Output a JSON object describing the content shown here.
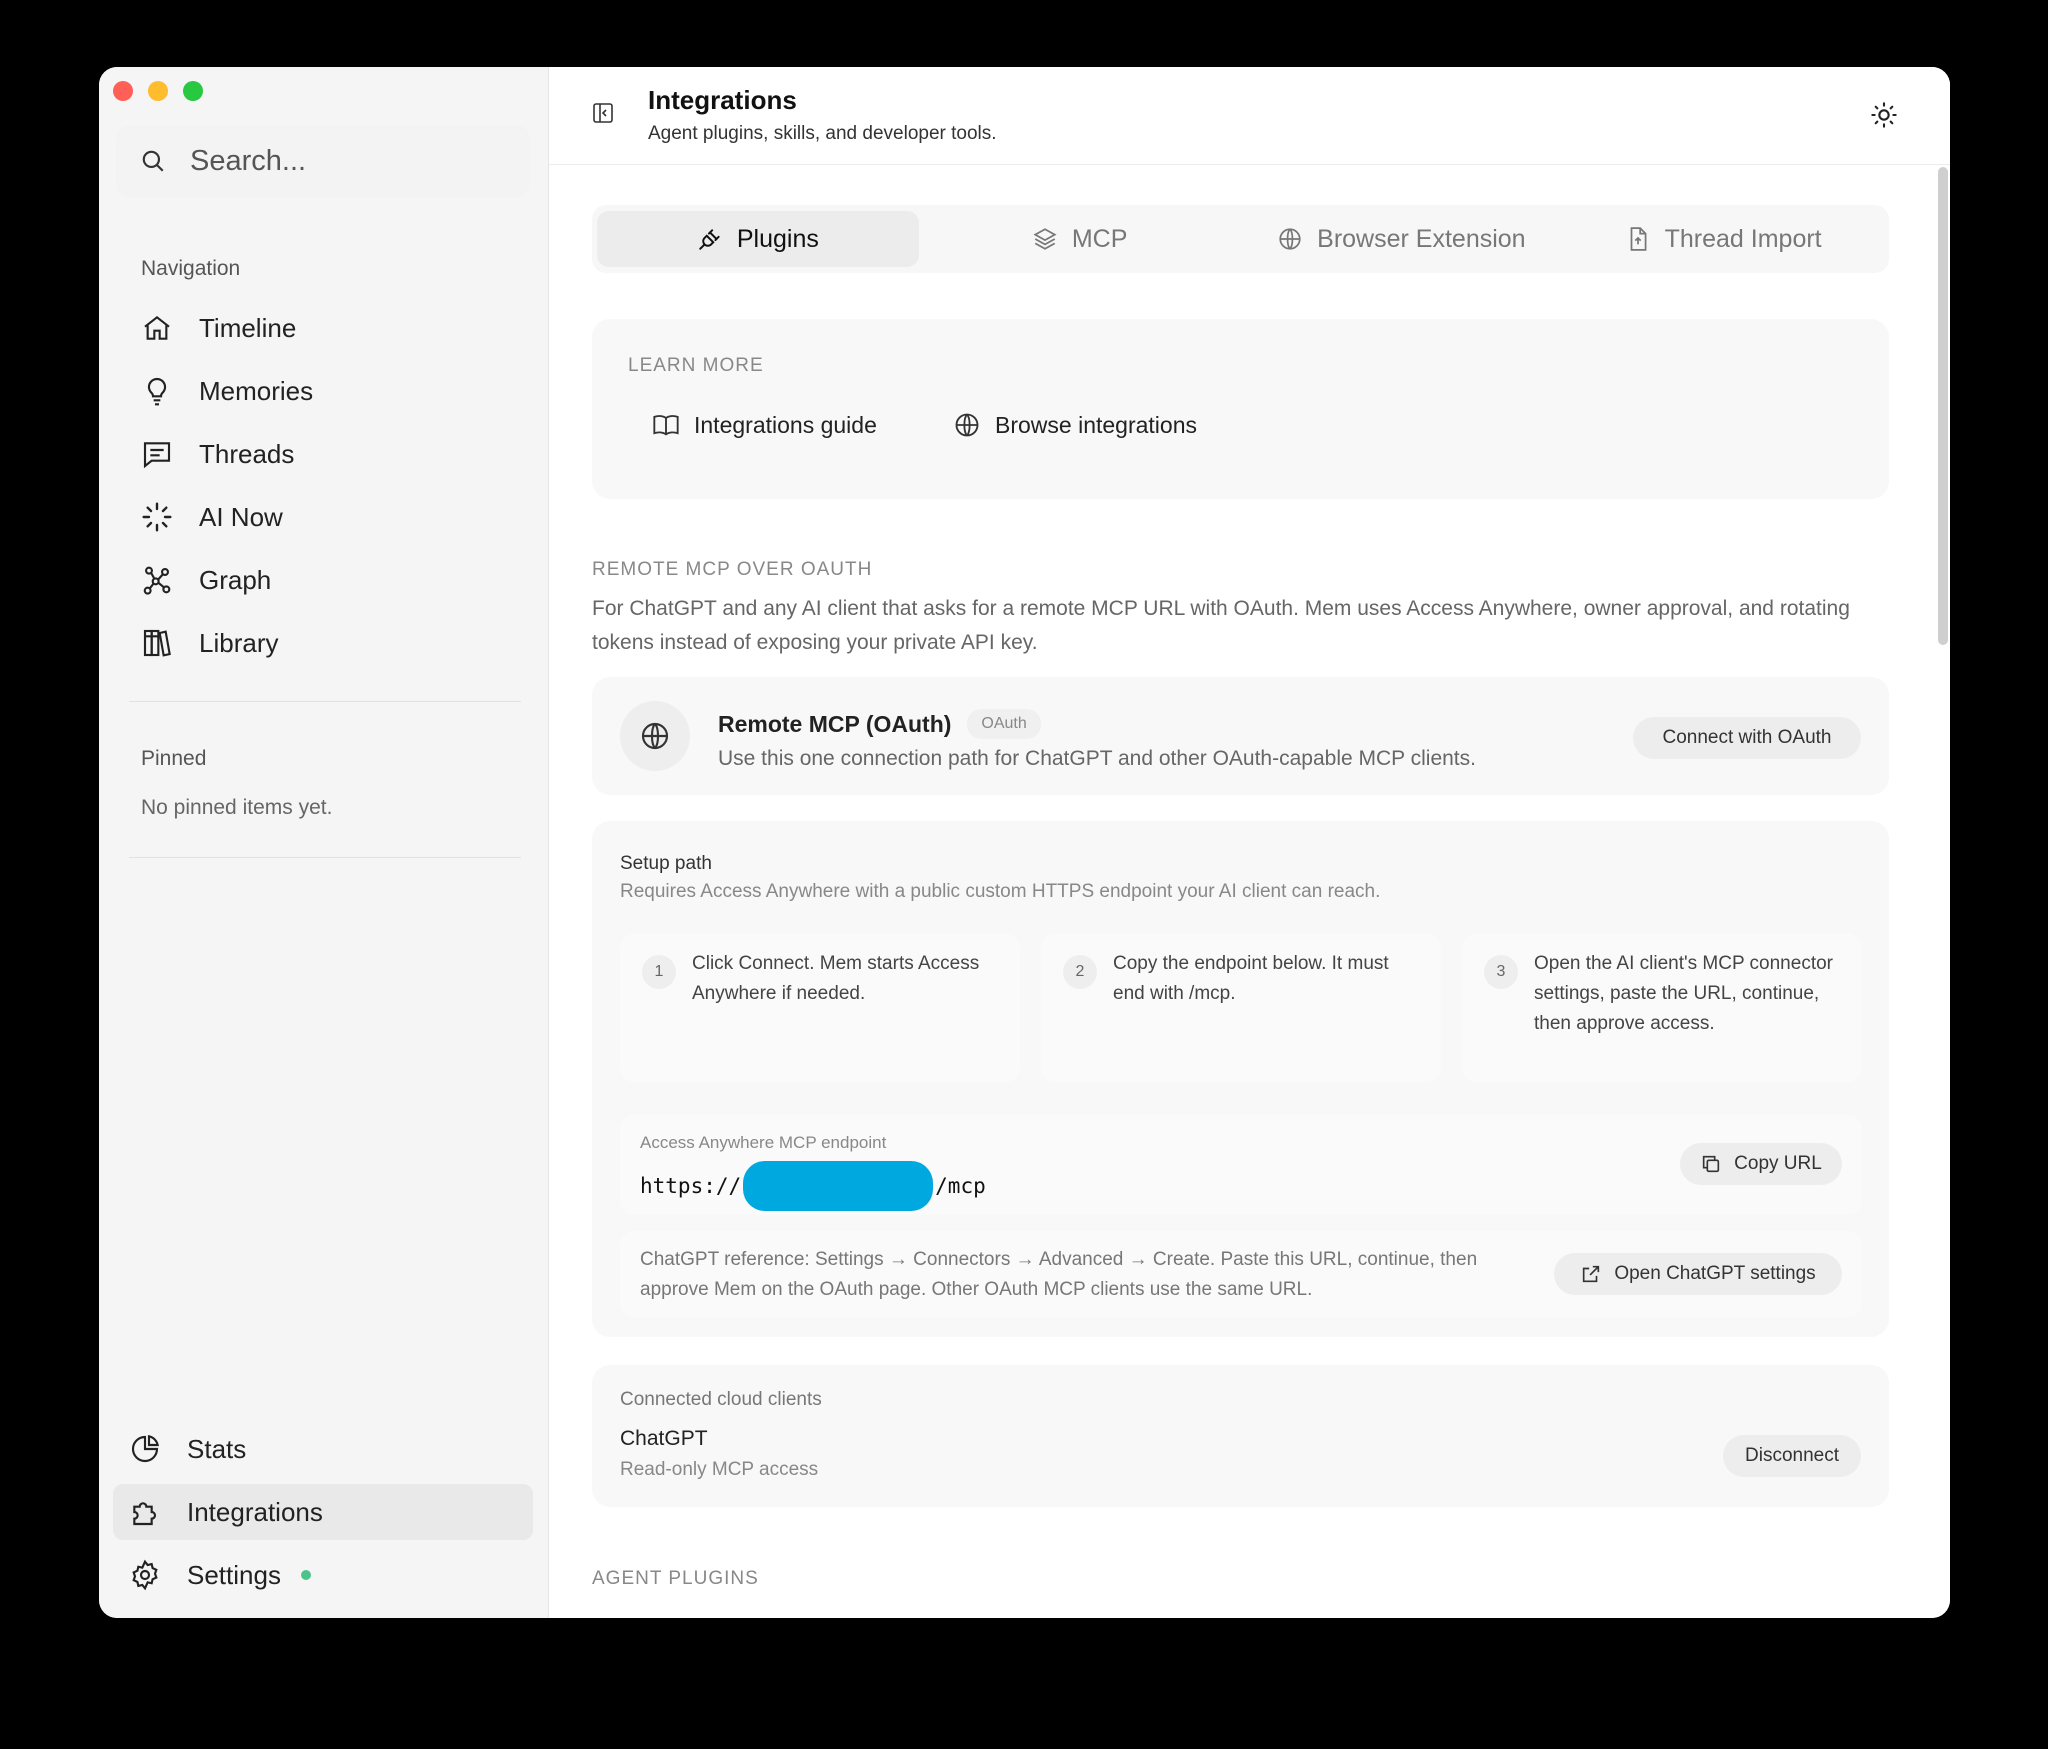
{
  "sidebar": {
    "search_placeholder": "Search...",
    "navigation_label": "Navigation",
    "nav_items": [
      {
        "label": "Timeline",
        "icon": "home-icon"
      },
      {
        "label": "Memories",
        "icon": "lightbulb-icon"
      },
      {
        "label": "Threads",
        "icon": "chat-icon"
      },
      {
        "label": "AI Now",
        "icon": "sparkle-icon"
      },
      {
        "label": "Graph",
        "icon": "graph-icon"
      },
      {
        "label": "Library",
        "icon": "library-icon"
      }
    ],
    "pinned_label": "Pinned",
    "pinned_empty": "No pinned items yet.",
    "bottom_items": [
      {
        "label": "Stats",
        "icon": "pie-chart-icon"
      },
      {
        "label": "Integrations",
        "icon": "puzzle-icon",
        "active": true
      },
      {
        "label": "Settings",
        "icon": "gear-icon",
        "status_dot": "#4cc38a"
      }
    ]
  },
  "header": {
    "title": "Integrations",
    "subtitle": "Agent plugins, skills, and developer tools."
  },
  "tabs": [
    {
      "label": "Plugins",
      "icon": "plug-icon",
      "active": true
    },
    {
      "label": "MCP",
      "icon": "layers-icon"
    },
    {
      "label": "Browser Extension",
      "icon": "globe-icon"
    },
    {
      "label": "Thread Import",
      "icon": "file-import-icon"
    }
  ],
  "learn_more": {
    "label": "LEARN MORE",
    "links": [
      {
        "label": "Integrations guide",
        "icon": "book-icon"
      },
      {
        "label": "Browse integrations",
        "icon": "globe-icon"
      }
    ]
  },
  "remote_mcp": {
    "section_title": "REMOTE MCP OVER OAUTH",
    "description": "For ChatGPT and any AI client that asks for a remote MCP URL with OAuth. Mem uses Access Anywhere, owner approval, and rotating tokens instead of exposing your private API key.",
    "card": {
      "name": "Remote MCP (OAuth)",
      "badge": "OAuth",
      "description": "Use this one connection path for ChatGPT and other OAuth-capable MCP clients.",
      "button": "Connect with OAuth"
    },
    "setup": {
      "title": "Setup path",
      "subtitle": "Requires Access Anywhere with a public custom HTTPS endpoint your AI client can reach.",
      "steps": [
        {
          "num": "1",
          "text": "Click Connect. Mem starts Access Anywhere if needed."
        },
        {
          "num": "2",
          "text": "Copy the endpoint below. It must end with /mcp."
        },
        {
          "num": "3",
          "text": "Open the AI client's MCP connector settings, paste the URL, continue, then approve access."
        }
      ],
      "endpoint_label": "Access Anywhere MCP endpoint",
      "endpoint_prefix": "https://",
      "endpoint_suffix": "/mcp",
      "copy_button": "Copy URL",
      "reference": "ChatGPT reference: Settings → Connectors → Advanced → Create. Paste this URL, continue, then approve Mem on the OAuth page. Other OAuth MCP clients use the same URL.",
      "open_settings_button": "Open ChatGPT settings"
    },
    "connected": {
      "title": "Connected cloud clients",
      "client_name": "ChatGPT",
      "client_desc": "Read-only MCP access",
      "disconnect_button": "Disconnect"
    }
  },
  "agent_plugins": {
    "section_title": "AGENT PLUGINS"
  },
  "colors": {
    "redaction": "#00a8e0",
    "status_green": "#4cc38a"
  }
}
